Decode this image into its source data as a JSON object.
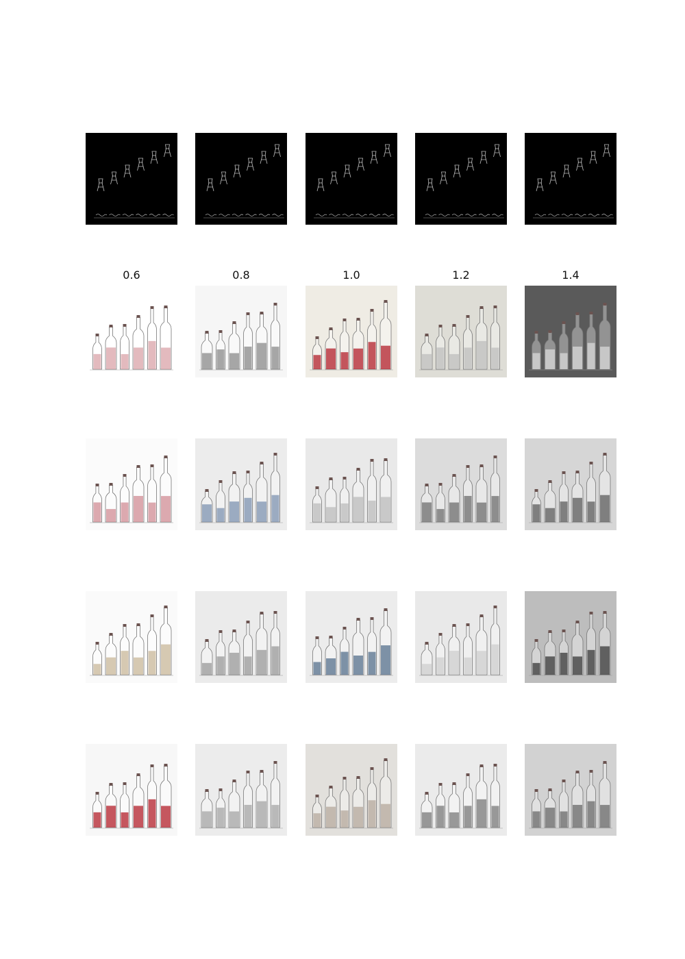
{
  "columns": [
    {
      "label": "0.6"
    },
    {
      "label": "0.8"
    },
    {
      "label": "1.0"
    },
    {
      "label": "1.2"
    },
    {
      "label": "1.4"
    }
  ],
  "colors": {
    "page_background": "#ffffff",
    "condition_background": "#000000",
    "sketch_line": "#bfbfbf",
    "red_liquid": "#b3202b",
    "pink_wash": "#d9a3a8",
    "blue_wash": "#7d93b0",
    "tan_wash": "#c9b89a",
    "grey_wash": "#8a8a8a"
  },
  "rows": [
    {
      "type": "condition-sketch",
      "cells": [
        {
          "icon": "bottle-sketch-condition-icon"
        },
        {
          "icon": "bottle-sketch-condition-icon"
        },
        {
          "icon": "bottle-sketch-condition-icon"
        },
        {
          "icon": "bottle-sketch-condition-icon"
        },
        {
          "icon": "bottle-sketch-condition-icon"
        }
      ]
    },
    {
      "type": "generated",
      "cells": [
        {
          "icon": "bottles-watercolor-icon",
          "bg": "#ffffff",
          "fill": "#d9a3a8"
        },
        {
          "icon": "bottles-watercolor-icon",
          "bg": "#f6f6f6",
          "fill": "#8a8a8a"
        },
        {
          "icon": "bottles-watercolor-icon",
          "bg": "#efece4",
          "fill": "#b3202b"
        },
        {
          "icon": "bottles-watercolor-icon",
          "bg": "#deddd6",
          "fill": "#bdbdbd"
        },
        {
          "icon": "bottles-watercolor-icon",
          "bg": "#5a5a5a",
          "fill": "#d8d8d8"
        }
      ]
    },
    {
      "type": "generated",
      "cells": [
        {
          "icon": "bottles-watercolor-icon",
          "bg": "#fbfbfb",
          "fill": "#d28e96"
        },
        {
          "icon": "bottles-watercolor-icon",
          "bg": "#ececec",
          "fill": "#7d93b0"
        },
        {
          "icon": "bottles-watercolor-icon",
          "bg": "#e9e9e9",
          "fill": "#bcbcbc"
        },
        {
          "icon": "bottles-watercolor-icon",
          "bg": "#dcdcdc",
          "fill": "#6f6f6f"
        },
        {
          "icon": "bottles-watercolor-icon",
          "bg": "#d6d6d6",
          "fill": "#5d5d5d"
        }
      ]
    },
    {
      "type": "generated",
      "cells": [
        {
          "icon": "bottles-watercolor-icon",
          "bg": "#fafafa",
          "fill": "#c9b89a"
        },
        {
          "icon": "bottles-watercolor-icon",
          "bg": "#ebebeb",
          "fill": "#9a9a9a"
        },
        {
          "icon": "bottles-watercolor-icon",
          "bg": "#ececec",
          "fill": "#56708c"
        },
        {
          "icon": "bottles-watercolor-icon",
          "bg": "#e9e9e9",
          "fill": "#cfcfcf"
        },
        {
          "icon": "bottles-watercolor-icon",
          "bg": "#bdbdbd",
          "fill": "#3a3a3a"
        }
      ]
    },
    {
      "type": "generated",
      "cells": [
        {
          "icon": "bottles-watercolor-icon",
          "bg": "#f7f7f7",
          "fill": "#b3202b"
        },
        {
          "icon": "bottles-watercolor-icon",
          "bg": "#ececec",
          "fill": "#a5a5a5"
        },
        {
          "icon": "bottles-watercolor-icon",
          "bg": "#e2e0dc",
          "fill": "#b5a89c"
        },
        {
          "icon": "bottles-watercolor-icon",
          "bg": "#ebebeb",
          "fill": "#7a7a7a"
        },
        {
          "icon": "bottles-watercolor-icon",
          "bg": "#d2d2d2",
          "fill": "#6a6a6a"
        }
      ]
    }
  ]
}
